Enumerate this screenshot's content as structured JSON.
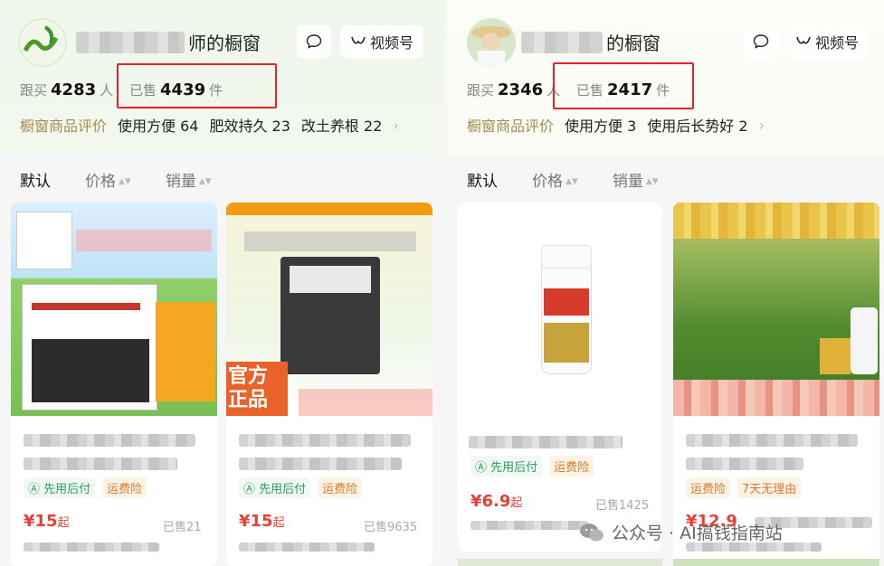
{
  "left": {
    "store_suffix": "师的橱窗",
    "msg_icon": "chat-bubble-icon",
    "video_label": "视频号",
    "follow_label": "跟买",
    "follow_count": "4283",
    "follow_unit": "人",
    "sold_label": "已售",
    "sold_count": "4439",
    "sold_unit": "件",
    "review_title": "橱窗商品评价",
    "reviews": [
      "使用方便 64",
      "肥效持久 23",
      "改土养根 22"
    ],
    "sort": [
      "默认",
      "价格",
      "销量"
    ],
    "cards": [
      {
        "pay": "先用后付",
        "ship": "运费险",
        "price": "¥15",
        "price_suffix": "起",
        "sold": "已售21"
      },
      {
        "pay": "先用后付",
        "ship": "运费险",
        "price": "¥15",
        "price_suffix": "起",
        "sold": "已售9635",
        "img_text1": "官方",
        "img_text2": "正品"
      }
    ]
  },
  "right": {
    "store_suffix": "的橱窗",
    "video_label": "视频号",
    "follow_label": "跟买",
    "follow_count": "2346",
    "follow_unit": "人",
    "sold_label": "已售",
    "sold_count": "2417",
    "sold_unit": "件",
    "review_title": "橱窗商品评价",
    "reviews": [
      "使用方便 3",
      "使用后长势好 2"
    ],
    "sort": [
      "默认",
      "价格",
      "销量"
    ],
    "cards": [
      {
        "pay": "先用后付",
        "ship": "运费险",
        "price": "¥6.9",
        "price_suffix": "起",
        "sold": "已售1425"
      },
      {
        "ship": "运费险",
        "ship2": "7天无理由",
        "price": "¥12.9"
      }
    ]
  },
  "watermark": "公众号 · AI搞钱指南站",
  "colors": {
    "accent_red": "#e8222a",
    "price": "#e6403a",
    "gold": "#a88a52"
  }
}
